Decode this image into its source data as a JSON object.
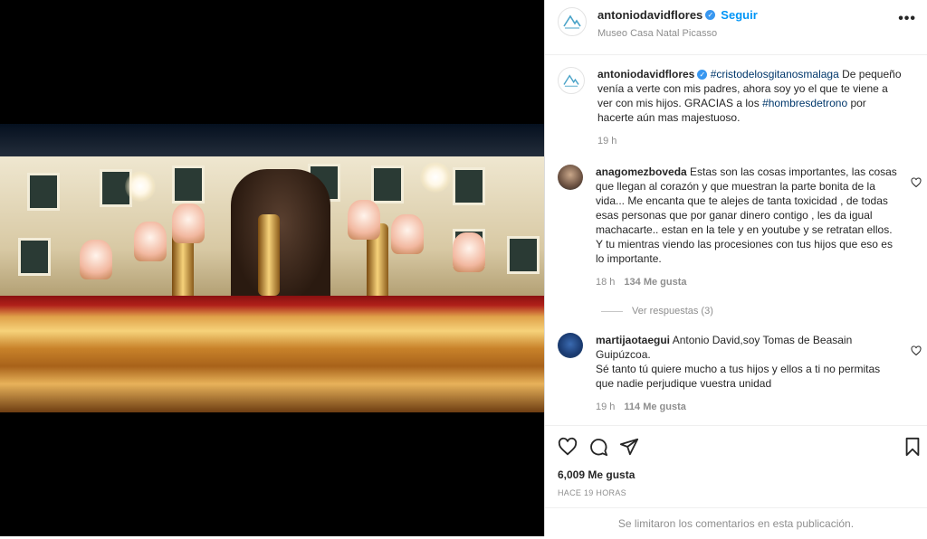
{
  "header": {
    "username": "antoniodavidflores",
    "follow_label": "Seguir",
    "location": "Museo Casa Natal Picasso",
    "more_label": "•••"
  },
  "caption": {
    "username": "antoniodavidflores",
    "hashtag1": "#cristodelosgitanosmalaga",
    "text1": " De pequeño venía a verte con mis padres, ahora soy yo el que te viene a ver con mis hijos. GRACIAS a los ",
    "hashtag2": "#hombresdetrono",
    "text2": " por hacerte aún mas majestuoso.",
    "time": "19 h"
  },
  "comments": [
    {
      "username": "anagomezboveda",
      "text": " Estas son las cosas importantes, las cosas que llegan al corazón y que muestran la parte bonita de la vida... Me encanta que te alejes de tanta toxicidad , de todas esas personas que por ganar dinero contigo , les da igual machacarte.. estan en la tele y en youtube y se retratan ellos. Y tu mientras viendo las procesiones con tus hijos que eso es lo importante.",
      "time": "18 h",
      "likes": "134 Me gusta"
    },
    {
      "username": "martijaotaegui",
      "text": " Antonio David,soy Tomas de Beasain Guipúzcoa.",
      "text2": "Sé tanto tú quiere mucho a tus hijos y ellos a ti no permitas que nadie perjudique vuestra unidad",
      "time": "19 h",
      "likes": "114 Me gusta"
    }
  ],
  "replies_label": "Ver respuestas (3)",
  "likes_count": "6,009 Me gusta",
  "post_time": "HACE 19 HORAS",
  "comments_limited": "Se limitaron los comentarios en esta publicación."
}
